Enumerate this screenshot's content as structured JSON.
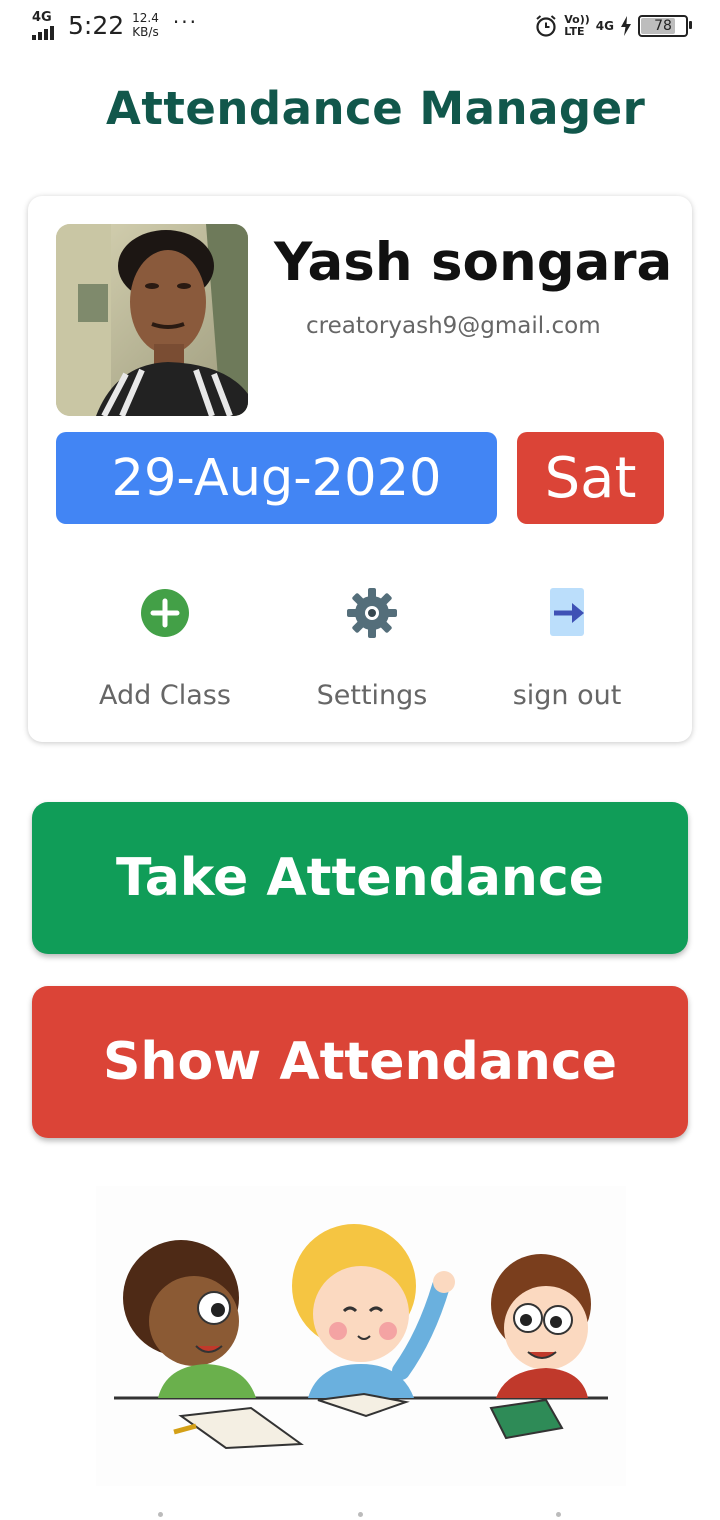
{
  "status_bar": {
    "network_left": "4G",
    "time": "5:22",
    "speed_value": "12.4",
    "speed_unit": "KB/s",
    "overflow": "···",
    "volte_top": "Vo))",
    "volte_bottom": "LTE",
    "network_right": "4G",
    "battery": "78",
    "icons": [
      "signal-icon",
      "alarm-icon",
      "charging-bolt-icon",
      "battery-icon"
    ]
  },
  "app": {
    "title": "Attendance Manager"
  },
  "profile": {
    "name": "Yash songara",
    "email": "creatoryash9@gmail.com",
    "date": "29-Aug-2020",
    "day": "Sat"
  },
  "actions": [
    {
      "label": "Add Class",
      "icon": "add-circle-icon",
      "color": "#43a047"
    },
    {
      "label": "Settings",
      "icon": "gear-icon",
      "color": "#546e7a"
    },
    {
      "label": "sign out",
      "icon": "sign-out-icon",
      "color": "#3f51b5"
    }
  ],
  "buttons": {
    "take": "Take Attendance",
    "show": "Show Attendance"
  },
  "colors": {
    "title": "#11574b",
    "date_chip": "#4285f4",
    "day_chip": "#db4437",
    "take_button": "#109d58",
    "show_button": "#db4437"
  }
}
